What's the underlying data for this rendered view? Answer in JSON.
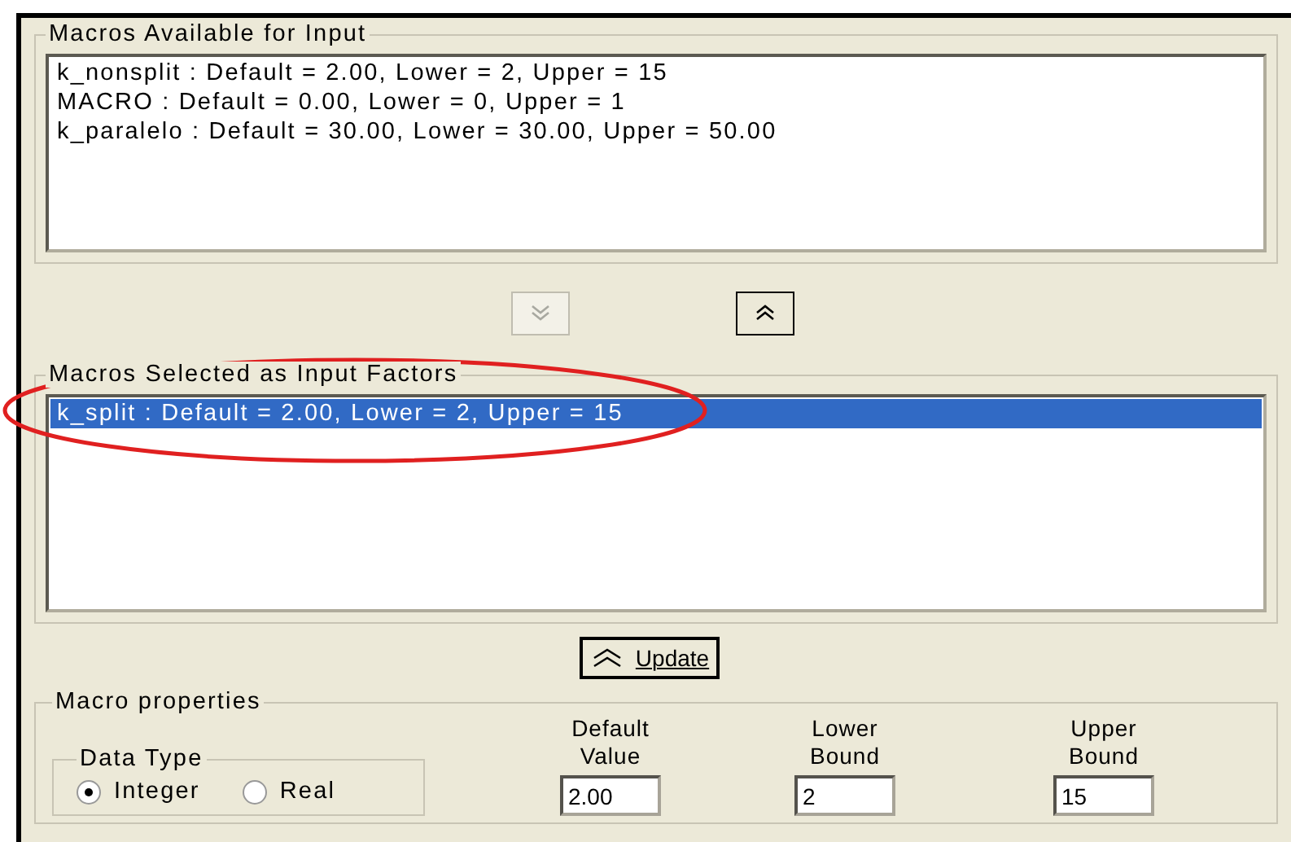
{
  "available": {
    "title": "Macros Available for Input",
    "items": [
      {
        "text": "k_nonsplit : Default = 2.00, Lower = 2, Upper = 15",
        "selected": false
      },
      {
        "text": "MACRO : Default = 0.00, Lower = 0, Upper = 1",
        "selected": false
      },
      {
        "text": "k_paralelo : Default = 30.00, Lower = 30.00, Upper = 50.00",
        "selected": false
      }
    ]
  },
  "move_buttons": [
    {
      "kind": "down",
      "disabled": true
    },
    {
      "kind": "up",
      "disabled": false
    }
  ],
  "selected_list": {
    "title": "Macros Selected as Input Factors",
    "items": [
      {
        "text": "k_split : Default = 2.00, Lower = 2, Upper = 15",
        "selected": true
      }
    ]
  },
  "update_button": {
    "label": "Update"
  },
  "properties": {
    "title": "Macro properties",
    "data_type": {
      "title": "Data Type",
      "options": [
        {
          "label": "Integer",
          "selected": true
        },
        {
          "label": "Real",
          "selected": false
        }
      ]
    },
    "fields": [
      {
        "label": [
          "Default",
          "Value"
        ],
        "value": "2.00"
      },
      {
        "label": [
          "Lower",
          "Bound"
        ],
        "value": "2"
      },
      {
        "label": [
          "Upper",
          "Bound"
        ],
        "value": "15"
      }
    ]
  }
}
